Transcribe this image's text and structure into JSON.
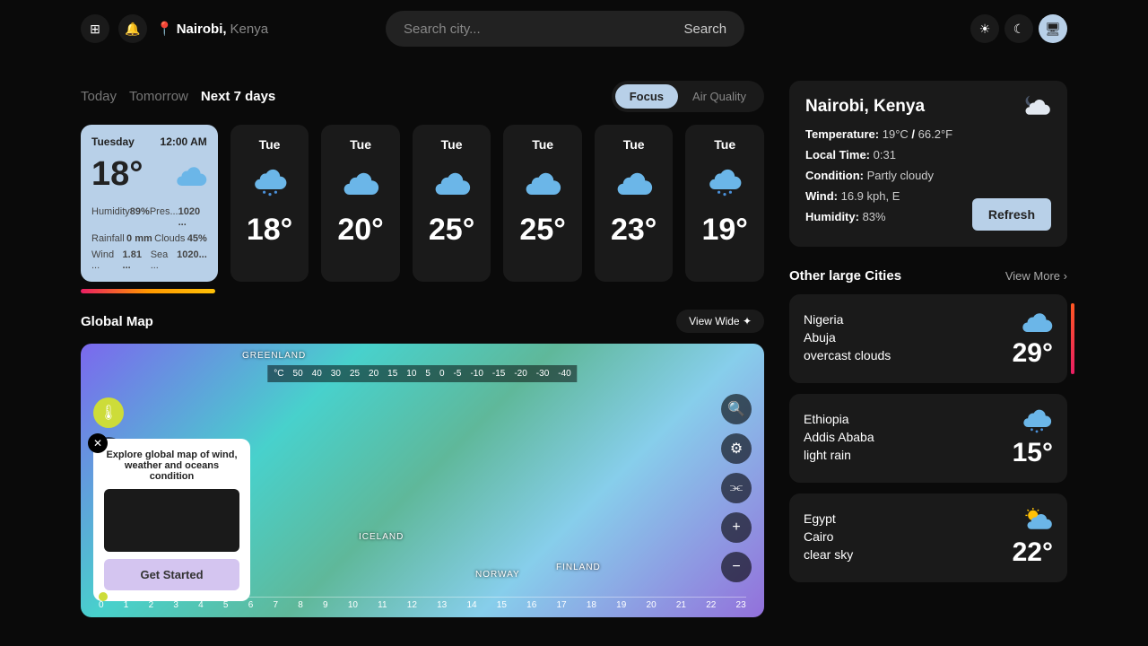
{
  "header": {
    "location_city": "Nairobi,",
    "location_country": "Kenya",
    "search_placeholder": "Search city...",
    "search_button": "Search"
  },
  "time_tabs": {
    "today": "Today",
    "tomorrow": "Tomorrow",
    "next7": "Next 7 days"
  },
  "mode_tabs": {
    "focus": "Focus",
    "air": "Air Quality"
  },
  "featured": {
    "day": "Tuesday",
    "time": "12:00 AM",
    "temp": "18°",
    "humidity_l": "Humidity",
    "humidity_v": "89%",
    "pressure_l": "Pres...",
    "pressure_v": "1020 ...",
    "rainfall_l": "Rainfall",
    "rainfall_v": "0 mm",
    "clouds_l": "Clouds",
    "clouds_v": "45%",
    "wind_l": "Wind ...",
    "wind_v": "1.81 ...",
    "sea_l": "Sea ...",
    "sea_v": "1020..."
  },
  "cards": [
    {
      "day": "Tue",
      "temp": "18°",
      "icon": "rain"
    },
    {
      "day": "Tue",
      "temp": "20°",
      "icon": "cloud"
    },
    {
      "day": "Tue",
      "temp": "25°",
      "icon": "cloud"
    },
    {
      "day": "Tue",
      "temp": "25°",
      "icon": "cloud"
    },
    {
      "day": "Tue",
      "temp": "23°",
      "icon": "cloud"
    },
    {
      "day": "Tue",
      "temp": "19°",
      "icon": "rain"
    }
  ],
  "map": {
    "title": "Global Map",
    "view_wide": "View Wide",
    "unit": "°C",
    "scale": [
      "50",
      "40",
      "30",
      "25",
      "20",
      "15",
      "10",
      "5",
      "0",
      "-5",
      "-10",
      "-15",
      "-20",
      "-30",
      "-40"
    ],
    "places": {
      "greenland": "GREENLAND",
      "iceland": "ICELAND",
      "norway": "NORWAY",
      "finland": "FINLAND"
    },
    "popup_text": "Explore global map of wind, weather and oceans condition",
    "popup_btn": "Get Started",
    "timeline": [
      "0",
      "1",
      "2",
      "3",
      "4",
      "5",
      "6",
      "7",
      "8",
      "9",
      "10",
      "11",
      "12",
      "13",
      "14",
      "15",
      "16",
      "17",
      "18",
      "19",
      "20",
      "21",
      "22",
      "23"
    ]
  },
  "info": {
    "title": "Nairobi, Kenya",
    "temp_l": "Temperature:",
    "temp_c": "19°C",
    "temp_sep": "/",
    "temp_f": "66.2°F",
    "time_l": "Local Time:",
    "time_v": "0:31",
    "cond_l": "Condition:",
    "cond_v": "Partly cloudy",
    "wind_l": "Wind:",
    "wind_v": "16.9 kph, E",
    "hum_l": "Humidity:",
    "hum_v": "83%",
    "refresh": "Refresh"
  },
  "cities": {
    "title": "Other large Cities",
    "view_more": "View More",
    "list": [
      {
        "country": "Nigeria",
        "city": "Abuja",
        "cond": "overcast clouds",
        "temp": "29°",
        "icon": "cloud"
      },
      {
        "country": "Ethiopia",
        "city": "Addis Ababa",
        "cond": "light rain",
        "temp": "15°",
        "icon": "rain"
      },
      {
        "country": "Egypt",
        "city": "Cairo",
        "cond": "clear sky",
        "temp": "22°",
        "icon": "sun"
      }
    ]
  }
}
